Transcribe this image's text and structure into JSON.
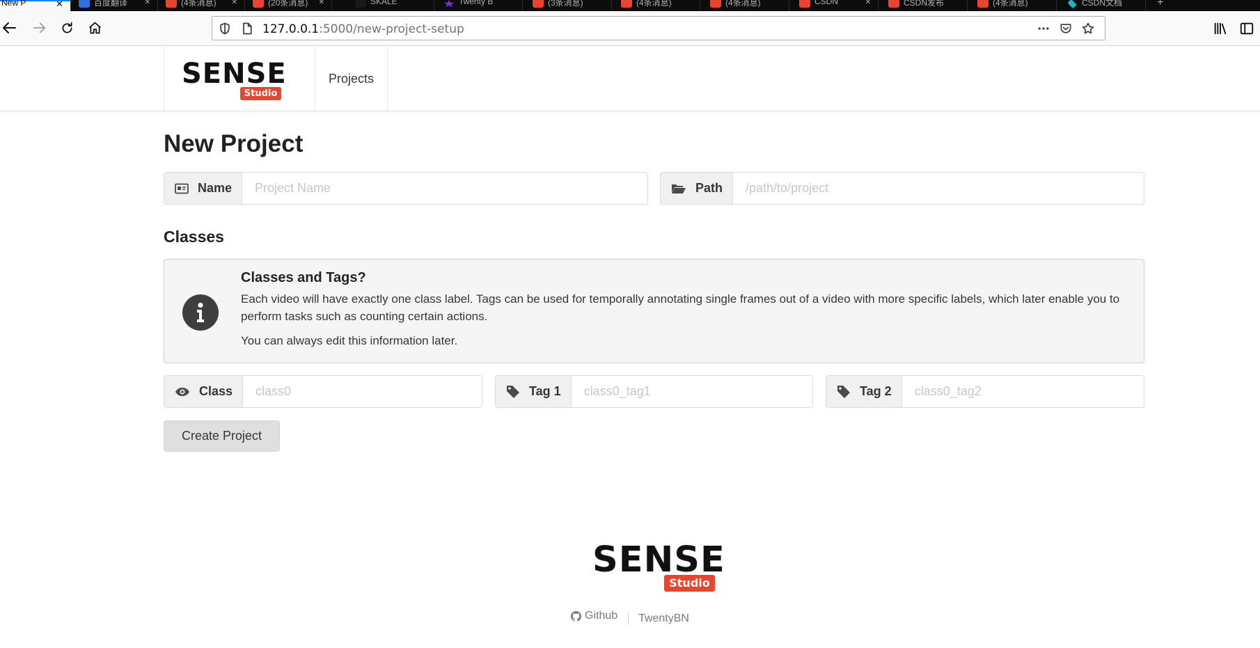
{
  "browser": {
    "tabs": [
      {
        "title": "New P",
        "active": true
      },
      {
        "title": "百度翻译"
      },
      {
        "title": "(4条消息)"
      },
      {
        "title": "(20条消息)"
      },
      {
        "title": "SKALE"
      },
      {
        "title": "Twenty B"
      },
      {
        "title": "(3条消息)"
      },
      {
        "title": "(4条消息)"
      },
      {
        "title": "(4条消息)"
      },
      {
        "title": "CSDN"
      },
      {
        "title": "CSDN发布"
      },
      {
        "title": "(4条消息)"
      },
      {
        "title": "CSDN文档"
      }
    ],
    "url_host": "127.0.0.1",
    "url_path": ":5000/new-project-setup",
    "colors": {
      "tab_strip": "#0c0c0d",
      "accent": "#0a84ff"
    }
  },
  "header": {
    "logo_word": "SENSE",
    "logo_badge": "Studio",
    "nav_projects": "Projects"
  },
  "page": {
    "title": "New Project",
    "name_field": {
      "label": "Name",
      "placeholder": "Project Name",
      "icon": "id-card-icon"
    },
    "path_field": {
      "label": "Path",
      "placeholder": "/path/to/project",
      "icon": "folder-open-icon"
    },
    "classes_heading": "Classes",
    "info": {
      "title": "Classes and Tags?",
      "body": "Each video will have exactly one class label. Tags can be used for temporally annotating single frames out of a video with more specific labels, which later enable you to perform tasks such as counting certain actions.",
      "note": "You can always edit this information later.",
      "icon": "info-circle-icon"
    },
    "class_field": {
      "label": "Class",
      "placeholder": "class0",
      "icon": "eye-icon"
    },
    "tag1_field": {
      "label": "Tag 1",
      "placeholder": "class0_tag1",
      "icon": "tag-icon"
    },
    "tag2_field": {
      "label": "Tag 2",
      "placeholder": "class0_tag2",
      "icon": "tag-icon"
    },
    "create_button": "Create Project"
  },
  "footer": {
    "logo_word": "SENSE",
    "logo_badge": "Studio",
    "github": "Github",
    "twentybn": "TwentyBN"
  },
  "colors": {
    "brand_badge": "#e8452f",
    "addon_bg": "#f0f0f0",
    "notice_bg": "#f5f5f5"
  }
}
